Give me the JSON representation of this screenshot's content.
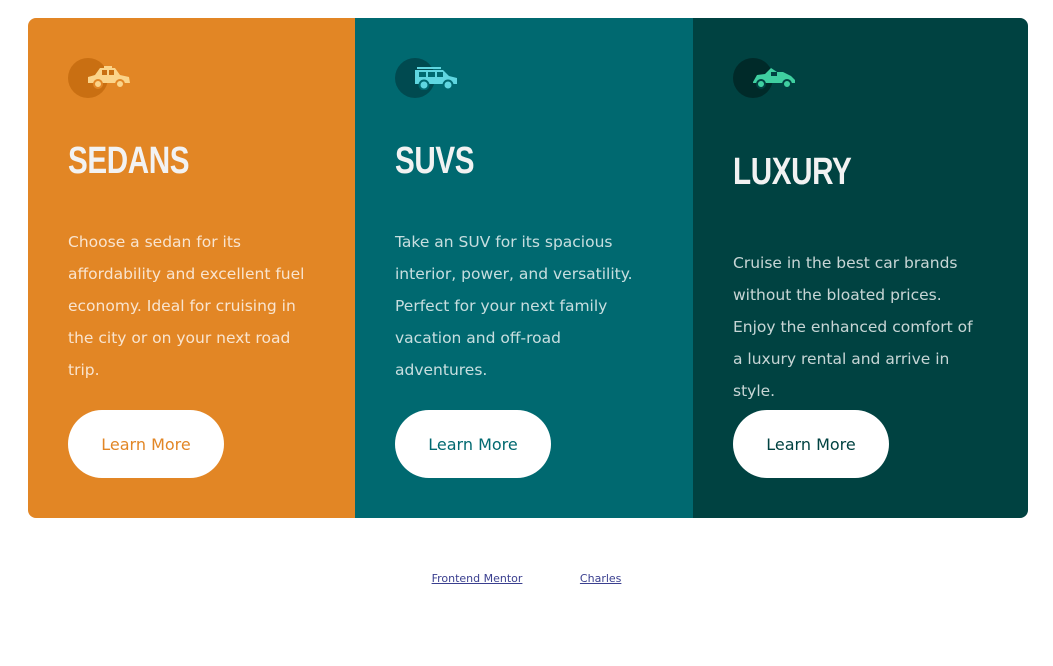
{
  "cards": [
    {
      "title": "SEDANS",
      "description": "Choose a sedan for its affordability and excellent fuel economy. Ideal for cruising in the city or on your next road trip.",
      "button_label": "Learn More",
      "icon": "sedan-car-icon",
      "bg_color": "#e28625",
      "icon_color": "#fbd48a"
    },
    {
      "title": "SUVS",
      "description": "Take an SUV for its spacious interior, power, and versatility. Perfect for your next family vacation and off-road adventures.",
      "button_label": "Learn More",
      "icon": "suv-car-icon",
      "bg_color": "#006970",
      "icon_color": "#5fd6e0"
    },
    {
      "title": "LUXURY",
      "description": "Cruise in the best car brands without the bloated prices. Enjoy the enhanced comfort of a luxury rental and arrive in style.",
      "button_label": "Learn More",
      "icon": "luxury-car-icon",
      "bg_color": "#004241",
      "icon_color": "#3fcfa0"
    }
  ],
  "footer": {
    "link1": "Frontend Mentor",
    "link2": "Charles"
  }
}
